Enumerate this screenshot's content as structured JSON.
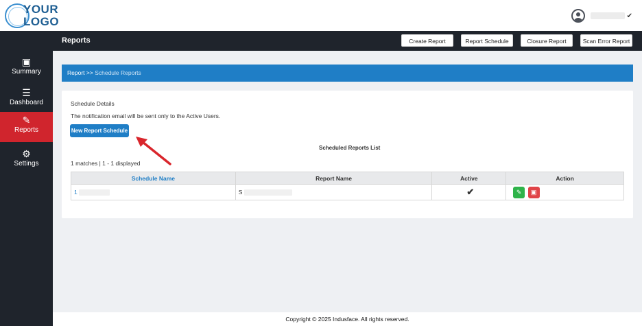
{
  "logo": {
    "line1": "YOUR",
    "line2": "LOGO"
  },
  "sidebar": {
    "items": [
      {
        "label": "Summary",
        "icon": "summary-icon"
      },
      {
        "label": "Dashboard",
        "icon": "dashboard-icon"
      },
      {
        "label": "Reports",
        "icon": "edit-icon"
      },
      {
        "label": "Settings",
        "icon": "gear-icon"
      }
    ]
  },
  "header": {
    "title": "Reports",
    "buttons": [
      "Create Report",
      "Report Schedule",
      "Closure Report",
      "Scan Error Report"
    ]
  },
  "breadcrumb": {
    "root": "Report",
    "sep": ">>",
    "current": "Schedule Reports"
  },
  "card": {
    "title": "Schedule Details",
    "notice": "The notification email will be sent only to the Active Users.",
    "new_button": "New Report Schedule",
    "list_title": "Scheduled Reports List",
    "matches": "1 matches | 1 - 1 displayed"
  },
  "table": {
    "headers": [
      "Schedule Name",
      "Report Name",
      "Active",
      "Action"
    ],
    "rows": [
      {
        "schedule_name": "1",
        "report_name": "S",
        "active": true
      }
    ]
  },
  "footer": "Copyright © 2025 Indusface. All rights reserved.",
  "colors": {
    "primary": "#1f7ec6",
    "sidebar": "#1f242c",
    "active": "#d0252d",
    "annotation": "#d9262c"
  }
}
